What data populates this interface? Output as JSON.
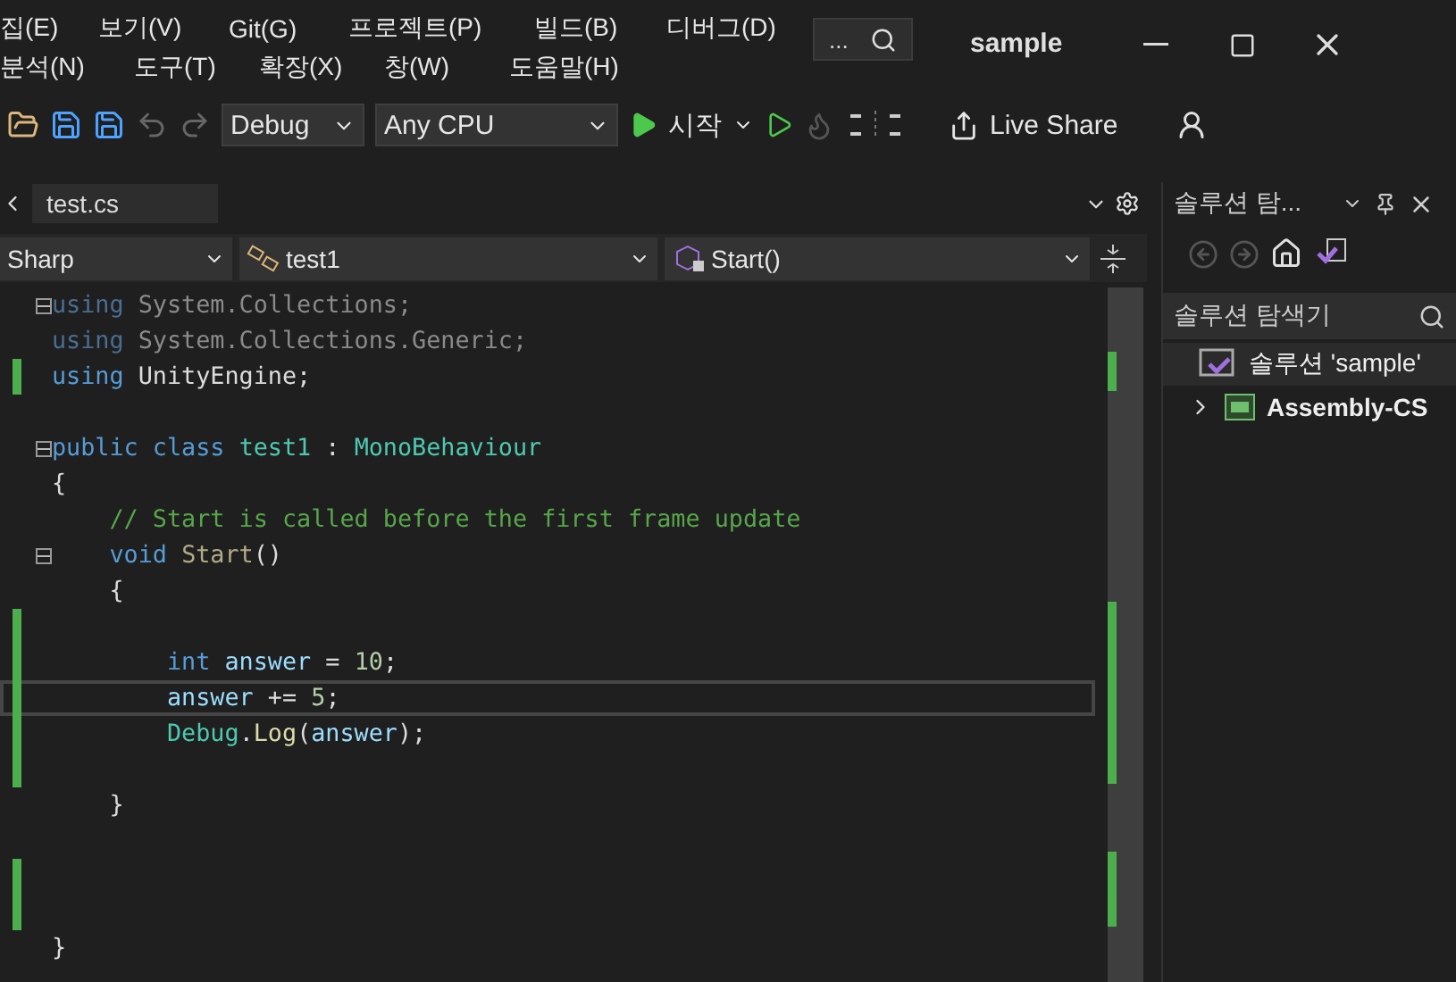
{
  "menu_rows": [
    [
      "집(E)",
      "보기(V)",
      "Git(G)",
      "프로젝트(P)",
      "빌드(B)",
      "디버그(D)"
    ],
    [
      "분석(N)",
      "도구(T)",
      "확장(X)",
      "창(W)",
      "도움말(H)"
    ]
  ],
  "search_button": "...",
  "window": {
    "title": "sample"
  },
  "toolbar": {
    "configuration": "Debug",
    "platform": "Any CPU",
    "start": "시작",
    "live_share": "Live Share"
  },
  "tabs": [
    {
      "label": "test.cs",
      "selected": true
    }
  ],
  "nav_bar": {
    "project": "Sharp",
    "class": "test1",
    "member": "Start()"
  },
  "code_lines": [
    {
      "fold": true,
      "changed": false,
      "current": false,
      "tokens": [
        {
          "kind": "faded-keyword",
          "text": "using"
        },
        {
          "kind": "faded",
          "text": " System.Collections;"
        }
      ]
    },
    {
      "fold": false,
      "changed": false,
      "current": false,
      "tokens": [
        {
          "kind": "faded-keyword",
          "text": "using"
        },
        {
          "kind": "faded",
          "text": " System.Collections.Generic;"
        }
      ]
    },
    {
      "fold": false,
      "changed": true,
      "current": false,
      "tokens": [
        {
          "kind": "keyword",
          "text": "using"
        },
        {
          "kind": "plain",
          "text": " UnityEngine;"
        }
      ]
    },
    {
      "fold": false,
      "changed": false,
      "current": false
    },
    {
      "fold": true,
      "changed": false,
      "current": false,
      "tokens": [
        {
          "kind": "keyword",
          "text": "public class "
        },
        {
          "kind": "type",
          "text": "test1"
        },
        {
          "kind": "plain",
          "text": " : "
        },
        {
          "kind": "type",
          "text": "MonoBehaviour"
        }
      ]
    },
    {
      "fold": false,
      "changed": false,
      "current": false,
      "tokens": [
        {
          "kind": "plain",
          "text": "{"
        }
      ]
    },
    {
      "fold": false,
      "changed": false,
      "current": false,
      "tokens": [
        {
          "kind": "comment",
          "text": "    // Start is called before the first frame update"
        }
      ]
    },
    {
      "fold": true,
      "changed": false,
      "current": false,
      "tokens": [
        {
          "kind": "keyword",
          "text": "    void "
        },
        {
          "kind": "faded-method",
          "text": "Start"
        },
        {
          "kind": "plain",
          "text": "()"
        }
      ]
    },
    {
      "fold": false,
      "changed": false,
      "current": false,
      "tokens": [
        {
          "kind": "plain",
          "text": "    {"
        }
      ]
    },
    {
      "fold": false,
      "changed": true,
      "current": false
    },
    {
      "fold": false,
      "changed": true,
      "current": false,
      "tokens": [
        {
          "kind": "keyword",
          "text": "        int "
        },
        {
          "kind": "variable",
          "text": "answer"
        },
        {
          "kind": "plain",
          "text": " = "
        },
        {
          "kind": "number",
          "text": "10"
        },
        {
          "kind": "plain",
          "text": ";"
        }
      ]
    },
    {
      "fold": false,
      "changed": true,
      "current": true,
      "tokens": [
        {
          "kind": "variable",
          "text": "        answer"
        },
        {
          "kind": "plain",
          "text": " += "
        },
        {
          "kind": "number",
          "text": "5"
        },
        {
          "kind": "plain",
          "text": ";"
        }
      ]
    },
    {
      "fold": false,
      "changed": true,
      "current": false,
      "tokens": [
        {
          "kind": "type",
          "text": "        Debug"
        },
        {
          "kind": "plain",
          "text": "."
        },
        {
          "kind": "method",
          "text": "Log"
        },
        {
          "kind": "plain",
          "text": "("
        },
        {
          "kind": "variable",
          "text": "answer"
        },
        {
          "kind": "plain",
          "text": ");"
        }
      ]
    },
    {
      "fold": false,
      "changed": true,
      "current": false
    },
    {
      "fold": false,
      "changed": false,
      "current": false,
      "tokens": [
        {
          "kind": "plain",
          "text": "    }"
        }
      ]
    },
    {
      "fold": false,
      "changed": false,
      "current": false
    },
    {
      "fold": false,
      "changed": true,
      "current": false
    },
    {
      "fold": false,
      "changed": true,
      "current": false
    },
    {
      "fold": false,
      "changed": false,
      "current": false,
      "tokens": [
        {
          "kind": "plain",
          "text": "}"
        }
      ]
    }
  ],
  "solution_explorer": {
    "title": "솔루션 탐...",
    "search_placeholder": "솔루션 탐색기",
    "tree": [
      {
        "label": "솔루션 'sample'",
        "selected": true,
        "expanded": true,
        "children": [
          {
            "label": "Assembly-CS",
            "selected": false,
            "expanded": false
          }
        ]
      }
    ]
  }
}
